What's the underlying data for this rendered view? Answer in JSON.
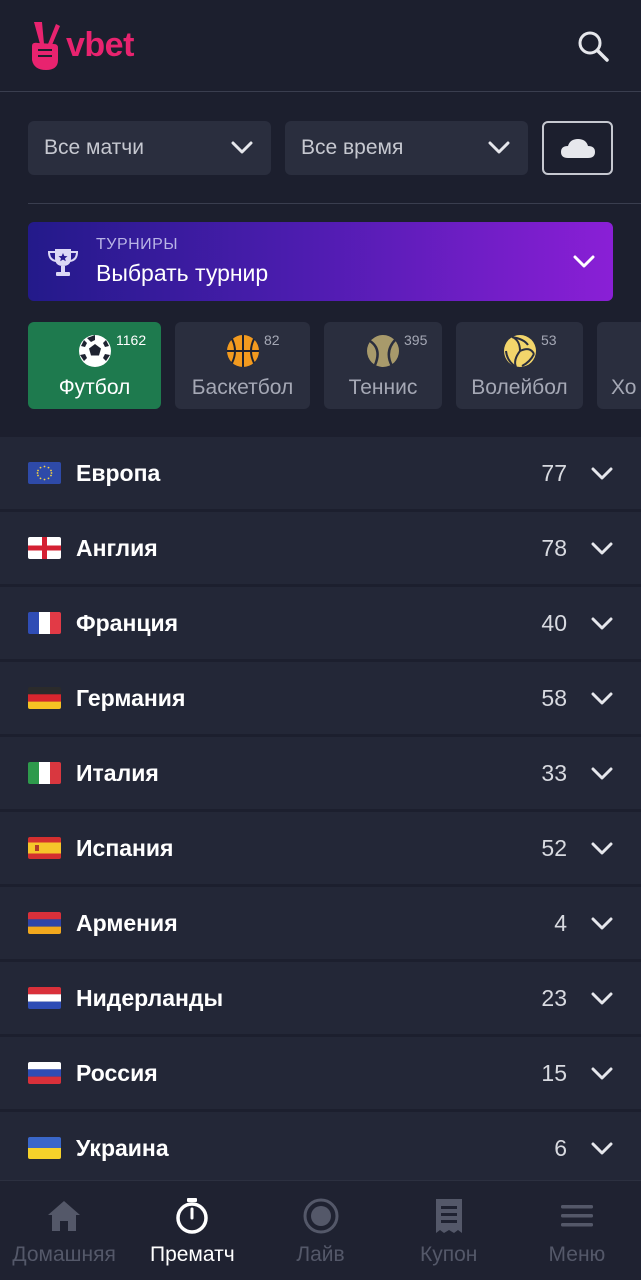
{
  "header": {
    "logo_text": "vbet"
  },
  "filters": {
    "matches": "Все матчи",
    "time": "Все время"
  },
  "tournament": {
    "label": "ТУРНИРЫ",
    "value": "Выбрать турнир"
  },
  "sports": [
    {
      "name": "Футбол",
      "count": "1162",
      "icon": "soccer-ball-icon"
    },
    {
      "name": "Баскетбол",
      "count": "82",
      "icon": "basketball-icon"
    },
    {
      "name": "Теннис",
      "count": "395",
      "icon": "tennis-ball-icon"
    },
    {
      "name": "Волейбол",
      "count": "53",
      "icon": "volleyball-icon"
    },
    {
      "name": "Хо",
      "count": "",
      "icon": "hockey-icon"
    }
  ],
  "countries": [
    {
      "name": "Европа",
      "count": "77",
      "flag": "eu-flag"
    },
    {
      "name": "Англия",
      "count": "78",
      "flag": "england-flag"
    },
    {
      "name": "Франция",
      "count": "40",
      "flag": "france-flag"
    },
    {
      "name": "Германия",
      "count": "58",
      "flag": "germany-flag"
    },
    {
      "name": "Италия",
      "count": "33",
      "flag": "italy-flag"
    },
    {
      "name": "Испания",
      "count": "52",
      "flag": "spain-flag"
    },
    {
      "name": "Армения",
      "count": "4",
      "flag": "armenia-flag"
    },
    {
      "name": "Нидерланды",
      "count": "23",
      "flag": "netherlands-flag"
    },
    {
      "name": "Россия",
      "count": "15",
      "flag": "russia-flag"
    },
    {
      "name": "Украина",
      "count": "6",
      "flag": "ukraine-flag"
    }
  ],
  "bottom_nav": [
    {
      "label": "Домашняя",
      "icon": "home-icon",
      "active": false
    },
    {
      "label": "Прематч",
      "icon": "stopwatch-icon",
      "active": true
    },
    {
      "label": "Лайв",
      "icon": "live-icon",
      "active": false
    },
    {
      "label": "Купон",
      "icon": "coupon-icon",
      "active": false
    },
    {
      "label": "Меню",
      "icon": "menu-icon",
      "active": false
    }
  ],
  "colors": {
    "accent": "#e8236f",
    "active_sport": "#1e7a4e",
    "background": "#1c1f2e",
    "row": "#232737"
  }
}
